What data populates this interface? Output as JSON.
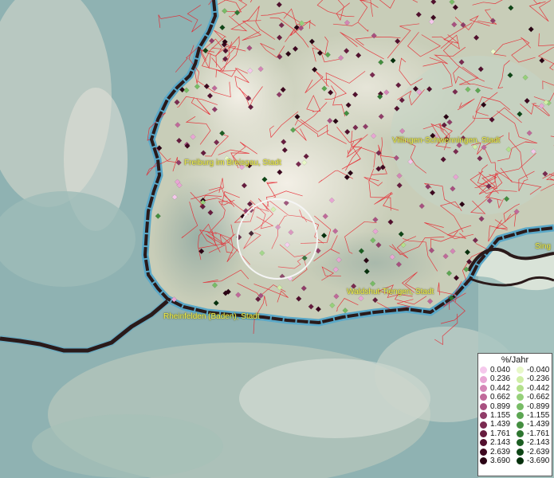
{
  "map": {
    "cities": [
      {
        "name": "Freiburg im Breisgau, Stadt"
      },
      {
        "name": "Villingen-Schwenningen, Stadt"
      },
      {
        "name": "Waldshut-Tiengen, Stadt"
      },
      {
        "name": "Rheinfelden (Baden), Stadt"
      },
      {
        "name": "Sing"
      }
    ],
    "colors": {
      "border": "#2a1a1a",
      "districts": "#e8202a",
      "lake": "#5aa8c8"
    }
  },
  "legend": {
    "title": "%/Jahr",
    "positive": [
      {
        "value": "0.040",
        "color": "#f5c8ec"
      },
      {
        "value": "0.236",
        "color": "#e8a6d4"
      },
      {
        "value": "0.442",
        "color": "#d486b6"
      },
      {
        "value": "0.662",
        "color": "#c06a9a"
      },
      {
        "value": "0.899",
        "color": "#a85080"
      },
      {
        "value": "1.155",
        "color": "#903c68"
      },
      {
        "value": "1.439",
        "color": "#7a2a50"
      },
      {
        "value": "1.761",
        "color": "#661c3e"
      },
      {
        "value": "2.143",
        "color": "#52102e"
      },
      {
        "value": "2.639",
        "color": "#3e0820"
      },
      {
        "value": "3.690",
        "color": "#2a0414"
      }
    ],
    "negative": [
      {
        "value": "-0.040",
        "color": "#e8f8c8"
      },
      {
        "value": "-0.236",
        "color": "#d0eea6"
      },
      {
        "value": "-0.442",
        "color": "#b4e08c"
      },
      {
        "value": "-0.662",
        "color": "#96d07a"
      },
      {
        "value": "-0.899",
        "color": "#78bc66"
      },
      {
        "value": "-1.155",
        "color": "#5ca652"
      },
      {
        "value": "-1.439",
        "color": "#448e40"
      },
      {
        "value": "-1.761",
        "color": "#2e7630"
      },
      {
        "value": "-2.143",
        "color": "#1c5e22"
      },
      {
        "value": "-2.639",
        "color": "#0e4616"
      },
      {
        "value": "-3.690",
        "color": "#05300c"
      }
    ]
  }
}
